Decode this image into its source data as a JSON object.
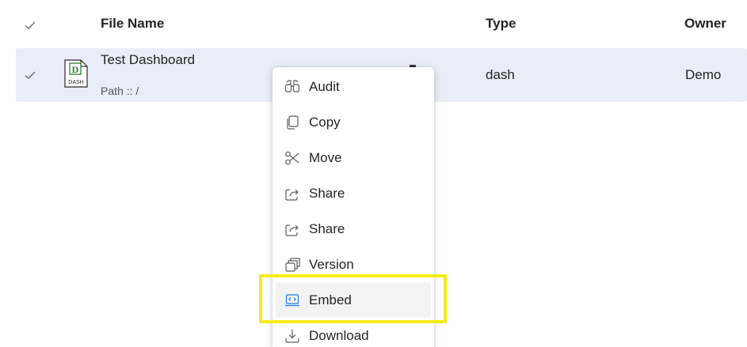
{
  "header": {
    "name_label": "File Name",
    "type_label": "Type",
    "owner_label": "Owner"
  },
  "file_row": {
    "name": "Test Dashboard",
    "path": "Path :: /",
    "type": "dash",
    "owner": "Demo",
    "icon_letter": "D",
    "icon_caption": "DASH",
    "icon": "dashboard-file-icon"
  },
  "menu": {
    "items": [
      {
        "label": "Audit",
        "icon": "binoculars-icon"
      },
      {
        "label": "Copy",
        "icon": "copy-icon"
      },
      {
        "label": "Move",
        "icon": "scissors-icon"
      },
      {
        "label": "Share",
        "icon": "share-icon"
      },
      {
        "label": "Share",
        "icon": "share-icon"
      },
      {
        "label": "Version",
        "icon": "version-icon"
      },
      {
        "label": "Embed",
        "icon": "embed-icon"
      },
      {
        "label": "Download",
        "icon": "download-icon"
      }
    ],
    "active_item": "Embed"
  },
  "colors": {
    "row_selected": "#e9edf7",
    "highlight": "#f4ec1b",
    "embed_icon": "#1f7ad6",
    "file_icon_green": "#2e7d32"
  }
}
